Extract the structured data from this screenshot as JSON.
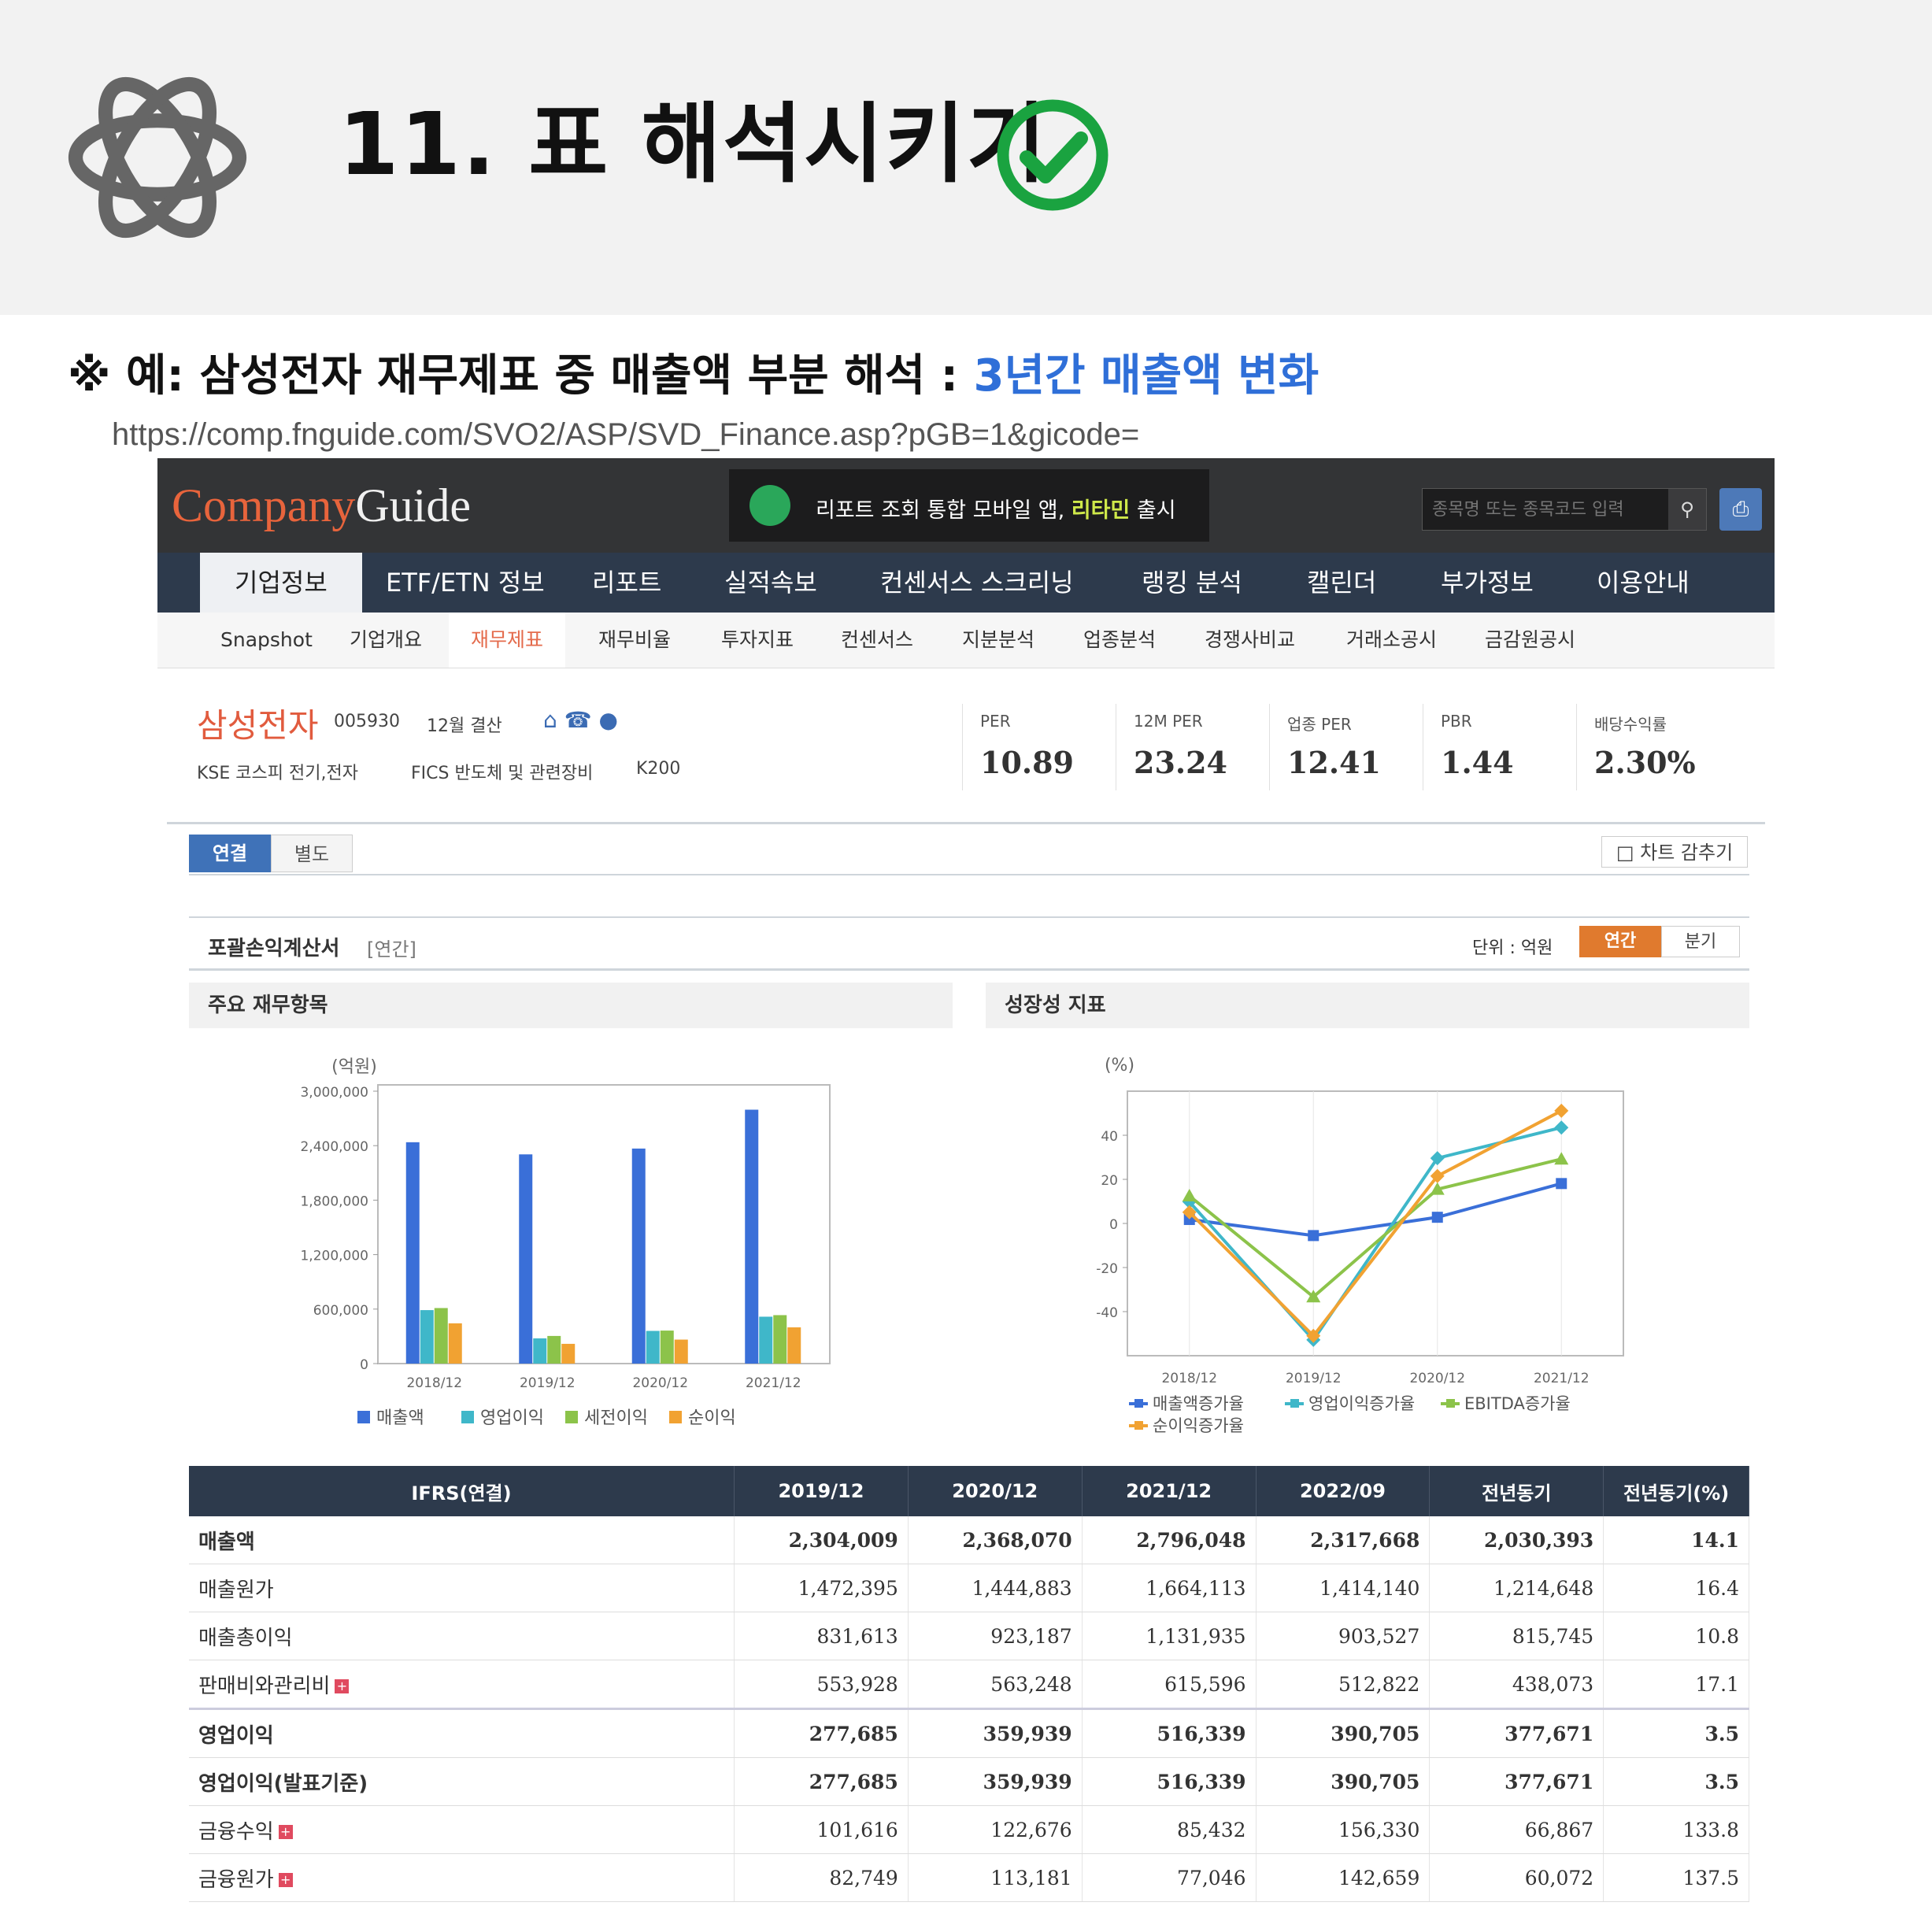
{
  "slide": {
    "title": "11. 표 해석시키기",
    "subtitle_prefix": "※ 예: 삼성전자 재무제표 중 매출액 부분 해석 : ",
    "subtitle_highlight": "3년간 매출액 변화",
    "url": "https://comp.fnguide.com/SVO2/ASP/SVD_Finance.asp?pGB=1&gicode=",
    "colors": {
      "highlight": "#2f6fd8",
      "check_green": "#1aa340"
    },
    "icons": [
      "openai-logo-icon",
      "check-circle-icon"
    ]
  },
  "site": {
    "brand_part1": "Company",
    "brand_part2": "Guide",
    "promo_text": "리포트 조회 통합 모바일 앱, ",
    "promo_em": "리타민",
    "promo_suffix": " 출시",
    "search_placeholder": "종목명 또는 종목코드 입력",
    "main_nav": [
      "기업정보",
      "ETF/ETN 정보",
      "리포트",
      "실적속보",
      "컨센서스 스크리닝",
      "랭킹 분석",
      "캘린더",
      "부가정보",
      "이용안내"
    ],
    "sub_nav": [
      "Snapshot",
      "기업개요",
      "재무제표",
      "재무비율",
      "투자지표",
      "컨센서스",
      "지분분석",
      "업종분석",
      "경쟁사비교",
      "거래소공시",
      "금감원공시"
    ]
  },
  "company": {
    "name": "삼성전자",
    "code": "005930",
    "settlement": "12월 결산",
    "market": "KSE  코스피 전기,전자",
    "fics": "FICS 반도체 및 관련장비",
    "index": "K200",
    "metrics": [
      {
        "label": "PER",
        "value": "10.89"
      },
      {
        "label": "12M PER",
        "value": "23.24"
      },
      {
        "label": "업종 PER",
        "value": "12.41"
      },
      {
        "label": "PBR",
        "value": "1.44"
      },
      {
        "label": "배당수익률",
        "value": "2.30%"
      }
    ]
  },
  "view": {
    "consolidated": "연결",
    "separate": "별도",
    "hide_chart": "차트 감추기",
    "statement_title": "포괄손익계산서",
    "statement_period": "[연간]",
    "unit": "단위 : 억원",
    "annual": "연간",
    "quarterly": "분기"
  },
  "charts": {
    "left_title": "주요 재무항목",
    "right_title": "성장성 지표"
  },
  "chart_data": [
    {
      "type": "bar",
      "ylabel": "(억원)",
      "categories": [
        "2018/12",
        "2019/12",
        "2020/12",
        "2021/12"
      ],
      "ylim": [
        0,
        3000000
      ],
      "yticks": [
        "3,000,000",
        "2,400,000",
        "1,800,000",
        "1,200,000",
        "600,000",
        "0"
      ],
      "series": [
        {
          "name": "매출액",
          "color": "#3a6fd8",
          "values": [
            2437714,
            2304009,
            2368070,
            2796048
          ]
        },
        {
          "name": "영업이익",
          "color": "#3fb7c9",
          "values": [
            588867,
            277685,
            359939,
            516339
          ]
        },
        {
          "name": "세전이익",
          "color": "#8cc34a",
          "values": [
            611600,
            304322,
            363451,
            533518
          ]
        },
        {
          "name": "순이익",
          "color": "#f1a232",
          "values": [
            443449,
            217389,
            264078,
            399074
          ]
        }
      ],
      "legend": "bottom"
    },
    {
      "type": "line",
      "ylabel": "(%)",
      "x": [
        "2018/12",
        "2019/12",
        "2020/12",
        "2021/12"
      ],
      "ylim": [
        -60,
        60
      ],
      "yticks": [
        "40",
        "20",
        "0",
        "-20",
        "-40"
      ],
      "series": [
        {
          "name": "매출액증가율",
          "color": "#3a6fd8",
          "values": [
            1.8,
            -5.5,
            2.8,
            18.1
          ]
        },
        {
          "name": "영업이익증가율",
          "color": "#3fb7c9",
          "values": [
            9.8,
            -52.8,
            29.6,
            43.5
          ]
        },
        {
          "name": "EBITDA증가율",
          "color": "#8cc34a",
          "values": [
            12.5,
            -33.3,
            15.5,
            29.2
          ]
        },
        {
          "name": "순이익증가율",
          "color": "#f1a232",
          "values": [
            5.1,
            -51.0,
            21.5,
            51.1
          ]
        }
      ],
      "legend": "bottom"
    }
  ],
  "table": {
    "headers": [
      "IFRS(연결)",
      "2019/12",
      "2020/12",
      "2021/12",
      "2022/09",
      "전년동기",
      "전년동기(%)"
    ],
    "rows": [
      {
        "label": "매출액",
        "plus": false,
        "bold": true,
        "cells": [
          "2,304,009",
          "2,368,070",
          "2,796,048",
          "2,317,668",
          "2,030,393",
          "14.1"
        ]
      },
      {
        "label": "매출원가",
        "plus": false,
        "bold": false,
        "cells": [
          "1,472,395",
          "1,444,883",
          "1,664,113",
          "1,414,140",
          "1,214,648",
          "16.4"
        ]
      },
      {
        "label": "매출총이익",
        "plus": false,
        "bold": false,
        "cells": [
          "831,613",
          "923,187",
          "1,131,935",
          "903,527",
          "815,745",
          "10.8"
        ]
      },
      {
        "label": "판매비와관리비",
        "plus": true,
        "bold": false,
        "cells": [
          "553,928",
          "563,248",
          "615,596",
          "512,822",
          "438,073",
          "17.1"
        ]
      },
      {
        "label": "영업이익",
        "plus": false,
        "bold": true,
        "cells": [
          "277,685",
          "359,939",
          "516,339",
          "390,705",
          "377,671",
          "3.5"
        ]
      },
      {
        "label": "영업이익(발표기준)",
        "plus": false,
        "bold": true,
        "cells": [
          "277,685",
          "359,939",
          "516,339",
          "390,705",
          "377,671",
          "3.5"
        ]
      },
      {
        "label": "금융수익",
        "plus": true,
        "bold": false,
        "cells": [
          "101,616",
          "122,676",
          "85,432",
          "156,330",
          "66,867",
          "133.8"
        ]
      },
      {
        "label": "금융원가",
        "plus": true,
        "bold": false,
        "cells": [
          "82,749",
          "113,181",
          "77,046",
          "142,659",
          "60,072",
          "137.5"
        ]
      }
    ]
  }
}
